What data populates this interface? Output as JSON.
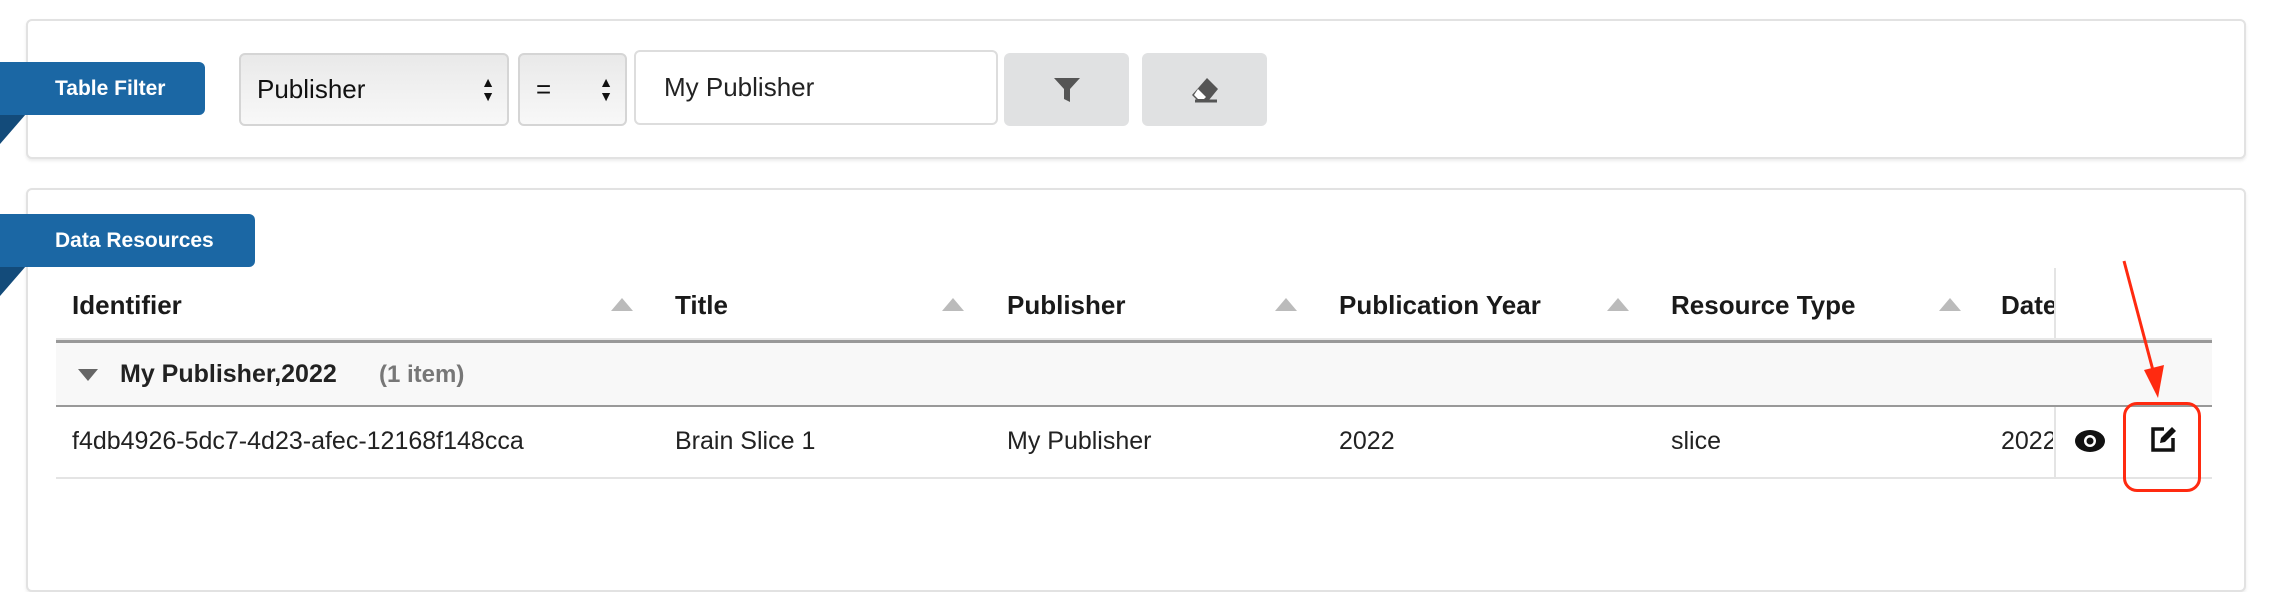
{
  "filter_panel": {
    "label": "Table Filter",
    "field_select": "Publisher",
    "operator_select": "=",
    "value_input": "My Publisher",
    "apply_icon": "filter-icon",
    "clear_icon": "eraser-icon"
  },
  "resources_panel": {
    "label": "Data Resources",
    "columns": [
      "Identifier",
      "Title",
      "Publisher",
      "Publication Year",
      "Resource Type",
      "Date"
    ],
    "group": {
      "label": "My Publisher,2022",
      "count": "(1 item)"
    },
    "rows": [
      {
        "identifier": "f4db4926-5dc7-4d23-afec-12168f148cca",
        "title": "Brain Slice 1",
        "publisher": "My Publisher",
        "year": "2022",
        "type": "slice",
        "date": "2022"
      }
    ],
    "row_actions": [
      "eye-icon",
      "edit-icon"
    ]
  },
  "colors": {
    "accent": "#1b67a4",
    "annotation": "#ff2a10"
  }
}
